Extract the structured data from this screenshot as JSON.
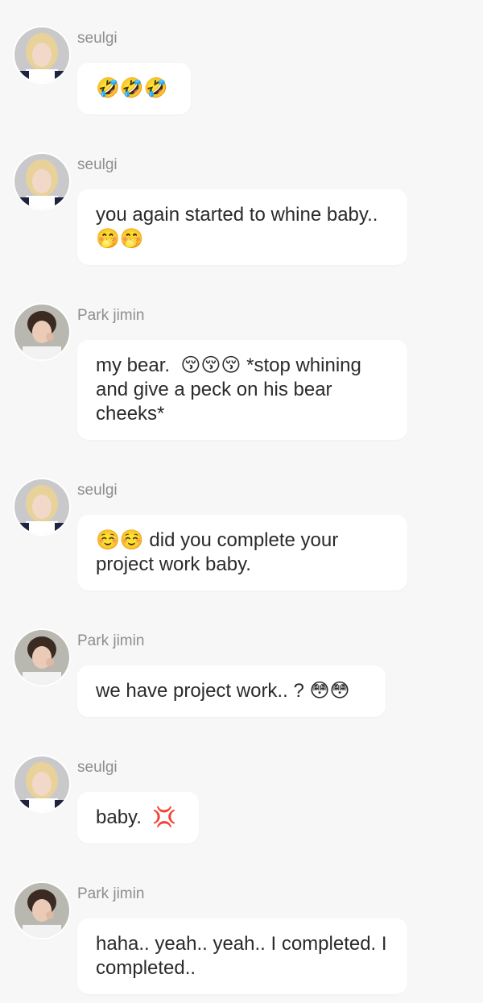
{
  "messages": [
    {
      "sender": "seulgi",
      "text": "🤣🤣🤣",
      "avatar": "seulgi-avatar"
    },
    {
      "sender": "seulgi",
      "text": "you again started to whine baby.. 🤭🤭",
      "avatar": "seulgi-avatar"
    },
    {
      "sender": "Park jimin",
      "text": "my bear.  😚😚😚 *stop whining and give a peck on his bear cheeks*",
      "avatar": "jimin-avatar"
    },
    {
      "sender": "seulgi",
      "text": "☺️☺️ did you complete your project work baby.",
      "avatar": "seulgi-avatar"
    },
    {
      "sender": "Park jimin",
      "text": "we have project work.. ? 😳😳",
      "avatar": "jimin-avatar"
    },
    {
      "sender": "seulgi",
      "text": "baby.  💢",
      "avatar": "seulgi-avatar"
    },
    {
      "sender": "Park jimin",
      "text": "haha.. yeah.. yeah.. I completed. I completed..",
      "avatar": "jimin-avatar"
    }
  ],
  "colors": {
    "background": "#f7f7f7",
    "bubble": "#ffffff",
    "sender_text": "#8e8e8e",
    "message_text": "#2b2b2b"
  }
}
